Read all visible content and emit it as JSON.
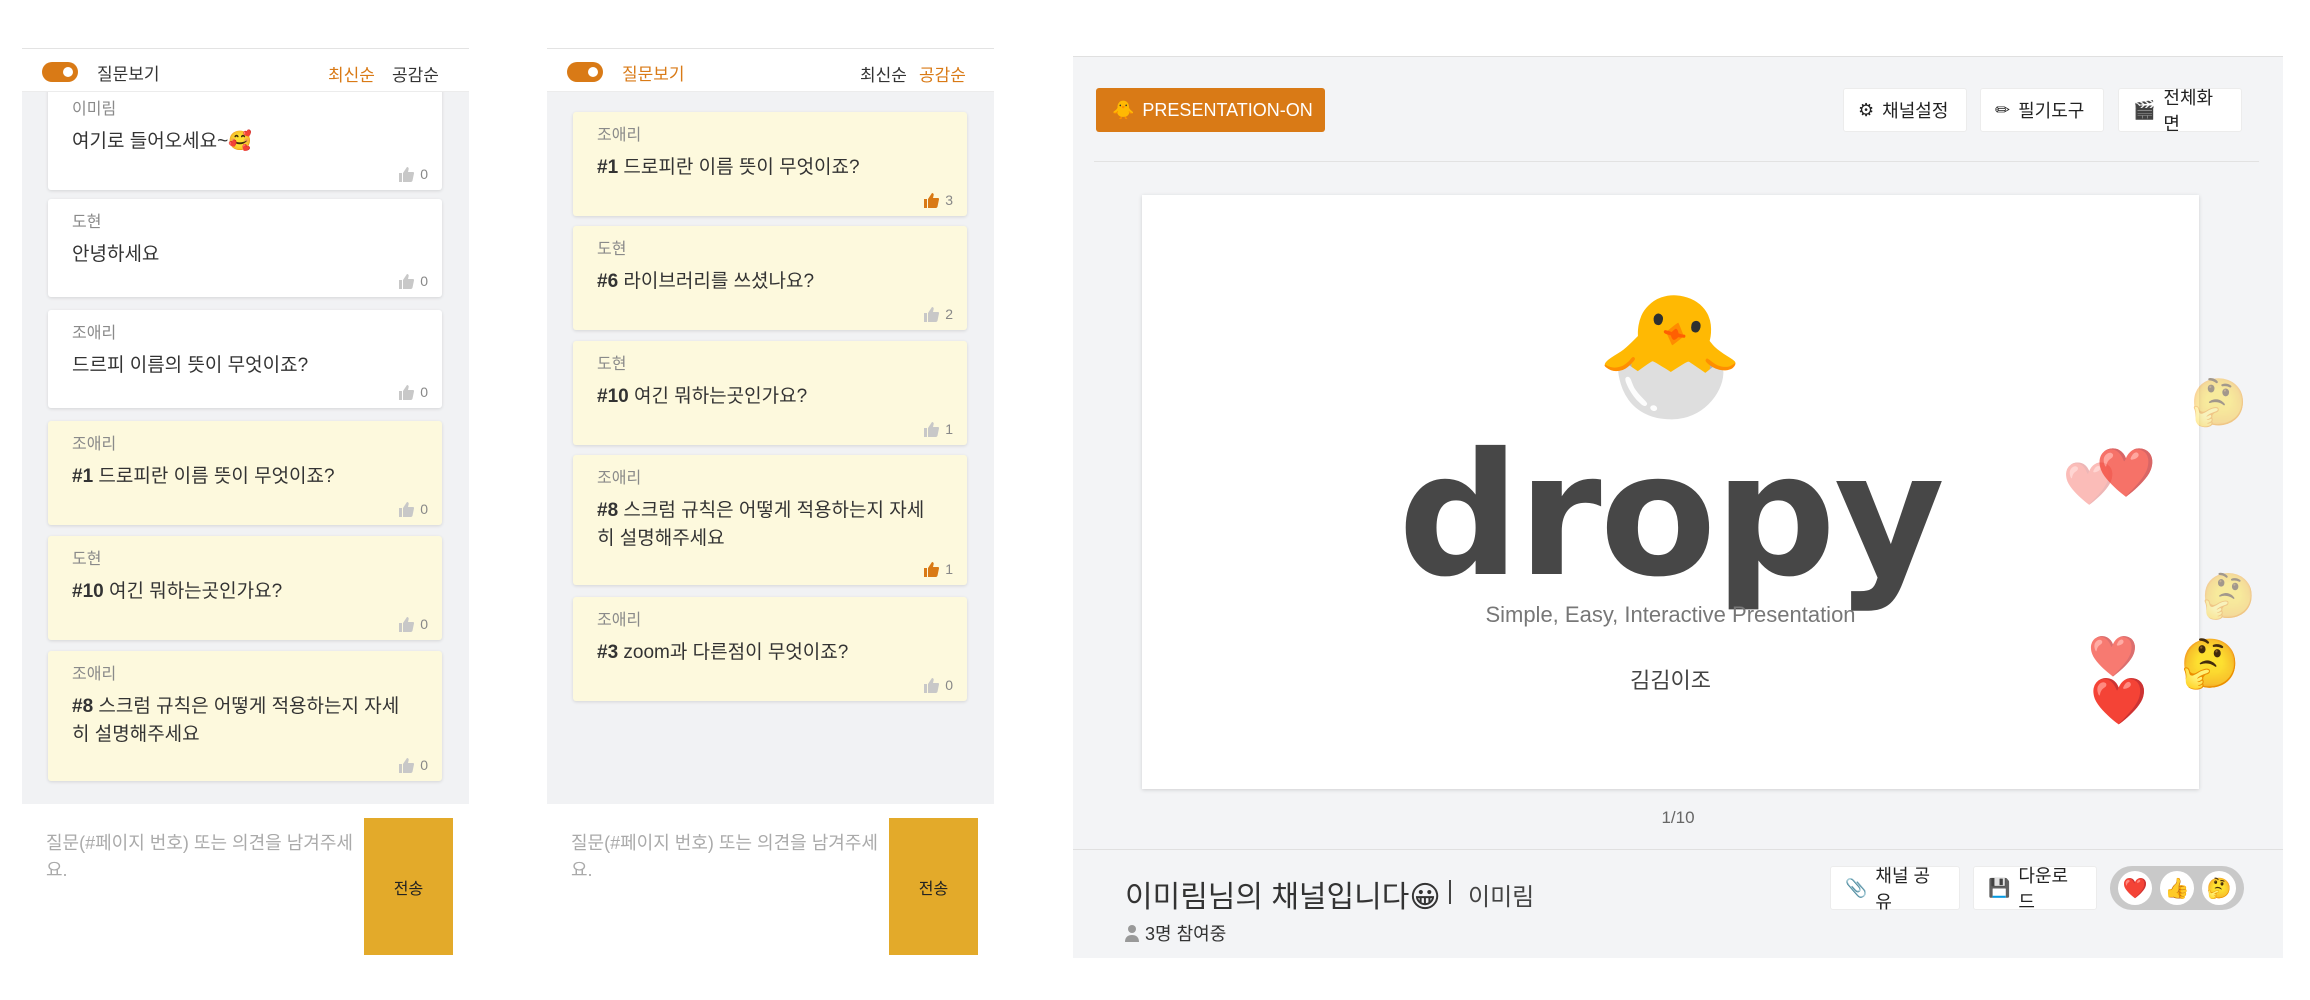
{
  "panel_left": {
    "toggle_label": "질문보기",
    "sort_latest": "최신순",
    "sort_empathy": "공감순",
    "active_sort": "latest",
    "messages": [
      {
        "author": "이미림",
        "num": "",
        "text": "여기로 들어오세요~🥰",
        "likes": "0",
        "question": false
      },
      {
        "author": "도현",
        "num": "",
        "text": "안녕하세요",
        "likes": "0",
        "question": false
      },
      {
        "author": "조애리",
        "num": "",
        "text": "드르피 이름의 뜻이 무엇이죠?",
        "likes": "0",
        "question": false
      },
      {
        "author": "조애리",
        "num": "#1",
        "text": " 드로피란 이름 뜻이 무엇이죠?",
        "likes": "0",
        "question": true
      },
      {
        "author": "도현",
        "num": "#10",
        "text": " 여긴 뭐하는곳인가요?",
        "likes": "0",
        "question": true
      },
      {
        "author": "조애리",
        "num": "#8",
        "text": " 스크럼 규칙은 어떻게 적용하는지 자세히 설명해주세요",
        "likes": "0",
        "question": true
      }
    ],
    "input_placeholder": "질문(#페이지 번호) 또는 의견을 남겨주세요.",
    "send_label": "전송"
  },
  "panel_right": {
    "toggle_label": "질문보기",
    "sort_latest": "최신순",
    "sort_empathy": "공감순",
    "active_sort": "empathy",
    "messages": [
      {
        "author": "조애리",
        "num": "#1",
        "text": " 드로피란 이름 뜻이 무엇이죠?",
        "likes": "3",
        "liked": true
      },
      {
        "author": "도현",
        "num": "#6",
        "text": " 라이브러리를 쓰셨나요?",
        "likes": "2",
        "liked": false
      },
      {
        "author": "도현",
        "num": "#10",
        "text": " 여긴 뭐하는곳인가요?",
        "likes": "1",
        "liked": false
      },
      {
        "author": "조애리",
        "num": "#8",
        "text": " 스크럼 규칙은 어떻게 적용하는지 자세히 설명해주세요",
        "likes": "1",
        "liked": true
      },
      {
        "author": "조애리",
        "num": "#3",
        "text": " zoom과 다른점이 무엇이죠?",
        "likes": "0",
        "liked": false
      }
    ],
    "input_placeholder": "질문(#페이지 번호) 또는 의견을 남겨주세요.",
    "send_label": "전송"
  },
  "presentation": {
    "brand_label": "PRESENTATION-ON",
    "brand_icon": "🐥",
    "toolbar": {
      "channel_settings": "채널설정",
      "pen_tool": "필기도구",
      "fullscreen": "전체화면",
      "channel_settings_icon": "⚙",
      "pen_tool_icon": "✏",
      "fullscreen_icon": "🎬"
    },
    "slide": {
      "logo_emoji": "🐣",
      "logo_word": "dropy",
      "tagline": "Simple, Easy, Interactive Presentation",
      "presenter": "김김이조"
    },
    "pager": "1/10",
    "channel_title": "이미림님의 채널입니다😀",
    "channel_owner": "이미림",
    "participants": "3명 참여중",
    "share_label": "채널 공유",
    "download_label": "다운로드",
    "share_icon": "📎",
    "download_icon": "💾",
    "reactions": [
      "❤️",
      "👍",
      "🤔"
    ],
    "accent_color": "#d97a16",
    "send_color": "#e3aa2a",
    "question_card_color": "#fdf9dd"
  }
}
